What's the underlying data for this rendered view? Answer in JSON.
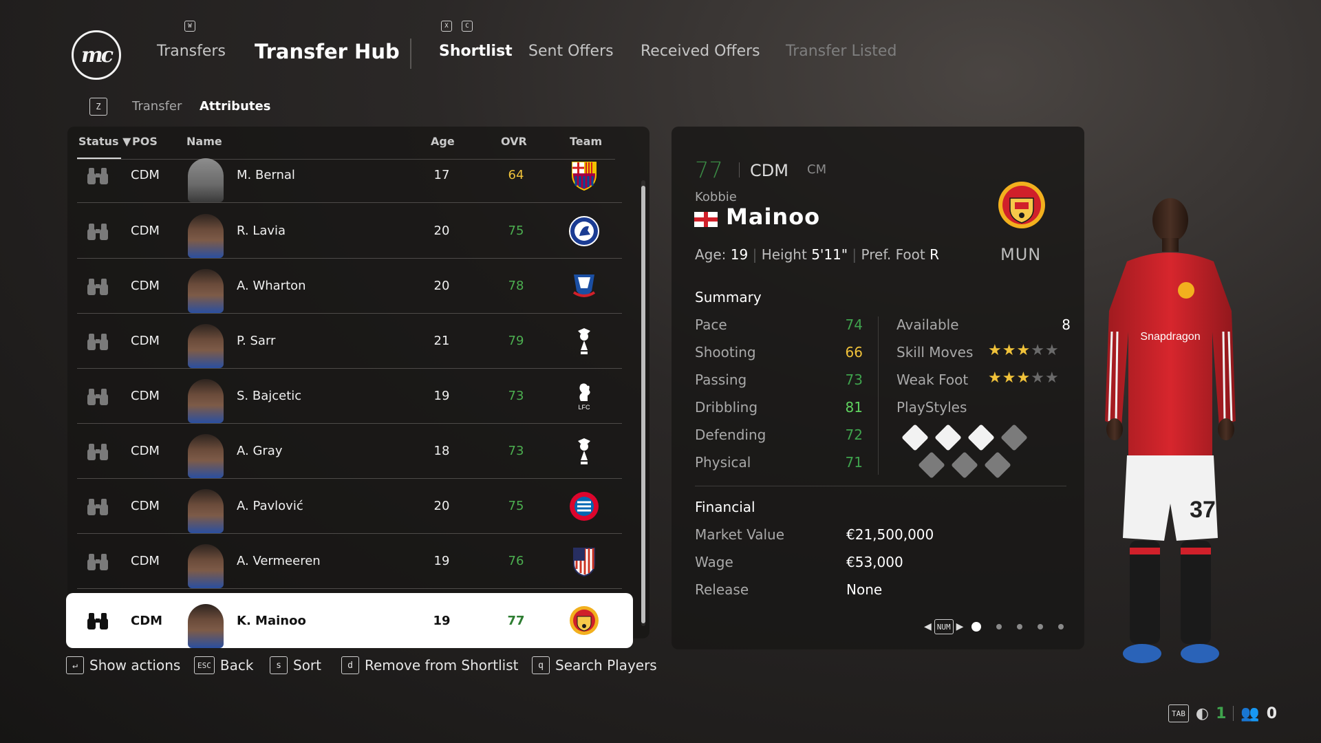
{
  "header": {
    "logo_text": "mc",
    "key_w": "W",
    "key_x": "X",
    "key_c": "C",
    "transfers": "Transfers",
    "transfer_hub": "Transfer Hub",
    "tabs": [
      {
        "label": "Shortlist",
        "state": "active"
      },
      {
        "label": "Sent Offers",
        "state": "normal"
      },
      {
        "label": "Received Offers",
        "state": "normal"
      },
      {
        "label": "Transfer Listed",
        "state": "dim"
      }
    ]
  },
  "subnav": {
    "key": "Z",
    "items": [
      "Transfer",
      "Attributes"
    ]
  },
  "table": {
    "headers": {
      "status": "Status",
      "pos": "POS",
      "name": "Name",
      "age": "Age",
      "ovr": "OVR",
      "team": "Team"
    },
    "rows": [
      {
        "pos": "CDM",
        "name": "M. Bernal",
        "age": "17",
        "ovr": "64",
        "ovr_color": "#f0c23a",
        "team": "barcelona-crest",
        "face": "silhouette"
      },
      {
        "pos": "CDM",
        "name": "R. Lavia",
        "age": "20",
        "ovr": "75",
        "ovr_color": "#4caf50",
        "team": "chelsea-crest"
      },
      {
        "pos": "CDM",
        "name": "A. Wharton",
        "age": "20",
        "ovr": "78",
        "ovr_color": "#4caf50",
        "team": "crystal-palace-crest"
      },
      {
        "pos": "CDM",
        "name": "P. Sarr",
        "age": "21",
        "ovr": "79",
        "ovr_color": "#4caf50",
        "team": "tottenham-crest"
      },
      {
        "pos": "CDM",
        "name": "S. Bajcetic",
        "age": "19",
        "ovr": "73",
        "ovr_color": "#4caf50",
        "team": "liverpool-crest"
      },
      {
        "pos": "CDM",
        "name": "A. Gray",
        "age": "18",
        "ovr": "73",
        "ovr_color": "#4caf50",
        "team": "tottenham-crest"
      },
      {
        "pos": "CDM",
        "name": "A. Pavlović",
        "age": "20",
        "ovr": "75",
        "ovr_color": "#4caf50",
        "team": "bayern-crest"
      },
      {
        "pos": "CDM",
        "name": "A. Vermeeren",
        "age": "19",
        "ovr": "76",
        "ovr_color": "#4caf50",
        "team": "atletico-crest"
      },
      {
        "pos": "CDM",
        "name": "K. Mainoo",
        "age": "19",
        "ovr": "77",
        "ovr_color": "#2e7d32",
        "team": "man-utd-crest",
        "selected": true
      }
    ]
  },
  "hints": [
    {
      "key": "↵",
      "label": "Show actions"
    },
    {
      "key": "ESC",
      "label": "Back"
    },
    {
      "key": "s",
      "label": "Sort"
    },
    {
      "key": "d",
      "label": "Remove from Shortlist"
    },
    {
      "key": "q",
      "label": "Search Players"
    }
  ],
  "player": {
    "ovr": "77",
    "pos": "CDM",
    "alt_pos": "CM",
    "first_name": "Kobbie",
    "last_name": "Mainoo",
    "age_label": "Age:",
    "age": "19",
    "height_label": "Height",
    "height": "5'11\"",
    "foot_label": "Pref. Foot",
    "foot": "R",
    "club_abbr": "MUN",
    "summary_title": "Summary",
    "stats": [
      {
        "label": "Pace",
        "value": "74",
        "color": "#3fa34d"
      },
      {
        "label": "Shooting",
        "value": "66",
        "color": "#f0c23a"
      },
      {
        "label": "Passing",
        "value": "73",
        "color": "#3fa34d"
      },
      {
        "label": "Dribbling",
        "value": "81",
        "color": "#5fd35f"
      },
      {
        "label": "Defending",
        "value": "72",
        "color": "#3fa34d"
      },
      {
        "label": "Physical",
        "value": "71",
        "color": "#3fa34d"
      }
    ],
    "available_label": "Available",
    "available": "8",
    "skill_moves_label": "Skill Moves",
    "skill_moves_stars": 3,
    "weak_foot_label": "Weak Foot",
    "weak_foot_stars": 3,
    "playstyles_label": "PlayStyles",
    "financial_title": "Financial",
    "market_value_label": "Market Value",
    "market_value": "€21,500,000",
    "wage_label": "Wage",
    "wage": "€53,000",
    "release_label": "Release",
    "release": "None",
    "pager_key": "NUM",
    "shirt_sponsor": "Snapdragon",
    "shirt_number": "37"
  },
  "indicators": {
    "tab_key": "TAB",
    "count_1": "1",
    "count_2": "0"
  },
  "colors": {
    "accent_green": "#3fa34d",
    "accent_yellow": "#f0c23a",
    "man_utd_red": "#d0202a"
  }
}
